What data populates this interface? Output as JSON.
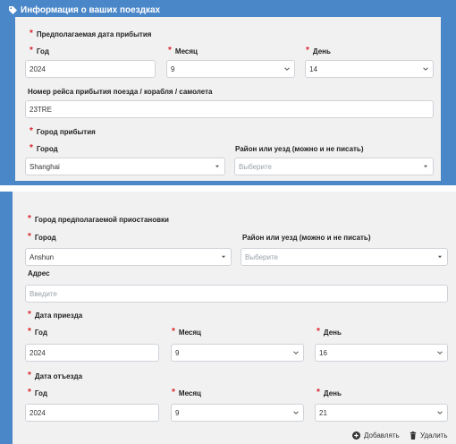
{
  "header": {
    "title": "Информация о ваших поездках"
  },
  "arrival": {
    "section_label": "Предполагаемая дата прибытия",
    "year_label": "Год",
    "year_value": "2024",
    "month_label": "Месяц",
    "month_value": "9",
    "day_label": "День",
    "day_value": "14",
    "flight_label": "Номер рейса прибытия поезда / корабля / самолета",
    "flight_value": "23TRE",
    "city_section_label": "Город прибытия",
    "city_label": "Город",
    "city_value": "Shanghai",
    "district_label": "Район или уезд (можно и не писать)",
    "district_placeholder": "Выберите"
  },
  "stay": {
    "section_label": "Город предполагаемой приостановки",
    "city_label": "Город",
    "city_value": "Anshun",
    "district_label": "Район или уезд (можно и не писать)",
    "district_placeholder": "Выберите",
    "address_label": "Адрес",
    "address_placeholder": "Введите",
    "arrive_label": "Дата приезда",
    "arrive_year_label": "Год",
    "arrive_year_value": "2024",
    "arrive_month_label": "Месяц",
    "arrive_month_value": "9",
    "arrive_day_label": "День",
    "arrive_day_value": "16",
    "depart_label": "Дата отъезда",
    "depart_year_label": "Год",
    "depart_year_value": "2024",
    "depart_month_label": "Месяц",
    "depart_month_value": "9",
    "depart_day_label": "День",
    "depart_day_value": "21"
  },
  "actions": {
    "add_label": "Добавлять",
    "delete_label": "Удалить"
  },
  "colors": {
    "accent": "#4a87c8",
    "required": "#d9262b",
    "card": "#f1f1f2"
  }
}
